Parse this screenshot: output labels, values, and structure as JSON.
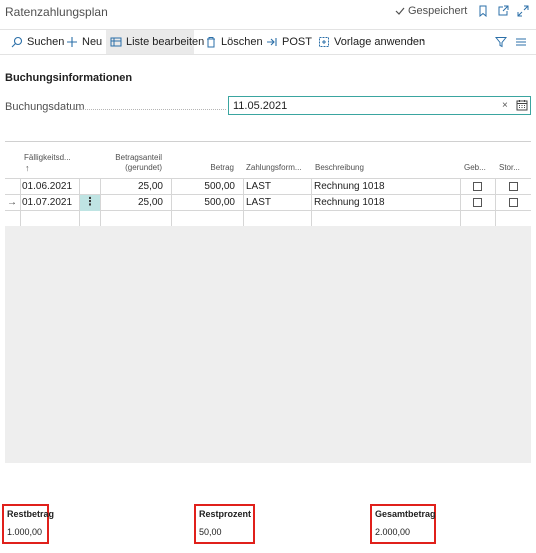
{
  "header": {
    "title": "Ratenzahlungsplan",
    "status": "Gespeichert"
  },
  "actions": {
    "search": "Suchen",
    "new": "Neu",
    "edit_list": "Liste bearbeiten",
    "delete": "Löschen",
    "post": "POST",
    "apply_template": "Vorlage anwenden",
    "more": "···"
  },
  "booking": {
    "section_title": "Buchungsinformationen",
    "date_label": "Buchungsdatum",
    "date_value": "11.05.2021",
    "clear_symbol": "×"
  },
  "grid": {
    "columns": {
      "due_date": "Fälligkeitsd...",
      "sort_indicator": "↑",
      "installment_line1": "Betragsanteil",
      "installment_line2": "(gerundet)",
      "amount": "Betrag",
      "payment_form": "Zahlungsform...",
      "description": "Beschreibung",
      "col_a": "Geb...",
      "col_b": "Stor..."
    },
    "rows": [
      {
        "due_date": "01.06.2021",
        "installment": "25,00",
        "amount": "500,00",
        "payment_form": "LAST",
        "description": "Rechnung 1018",
        "col_a": false,
        "col_b": false,
        "selected": false
      },
      {
        "due_date": "01.07.2021",
        "installment": "25,00",
        "amount": "500,00",
        "payment_form": "LAST",
        "description": "Rechnung 1018",
        "col_a": false,
        "col_b": false,
        "selected": true
      }
    ],
    "row_arrow": "→",
    "row_menu": "⋮"
  },
  "totals": {
    "rest_amount_label": "Restbetrag",
    "rest_amount_value": "1.000,00",
    "rest_percent_label": "Restprozent",
    "rest_percent_value": "50,00",
    "total_amount_label": "Gesamtbetrag",
    "total_amount_value": "2.000,00"
  },
  "colors": {
    "accent": "#3aa5a0",
    "highlight": "#e0201b",
    "selected_cell": "#bfe4e3"
  },
  "icons": [
    "checkmark-icon",
    "bookmark-icon",
    "open-new-icon",
    "expand-icon",
    "search-icon",
    "plus-icon",
    "edit-list-icon",
    "trash-icon",
    "post-icon",
    "template-icon",
    "filter-icon",
    "list-icon",
    "calendar-icon"
  ]
}
